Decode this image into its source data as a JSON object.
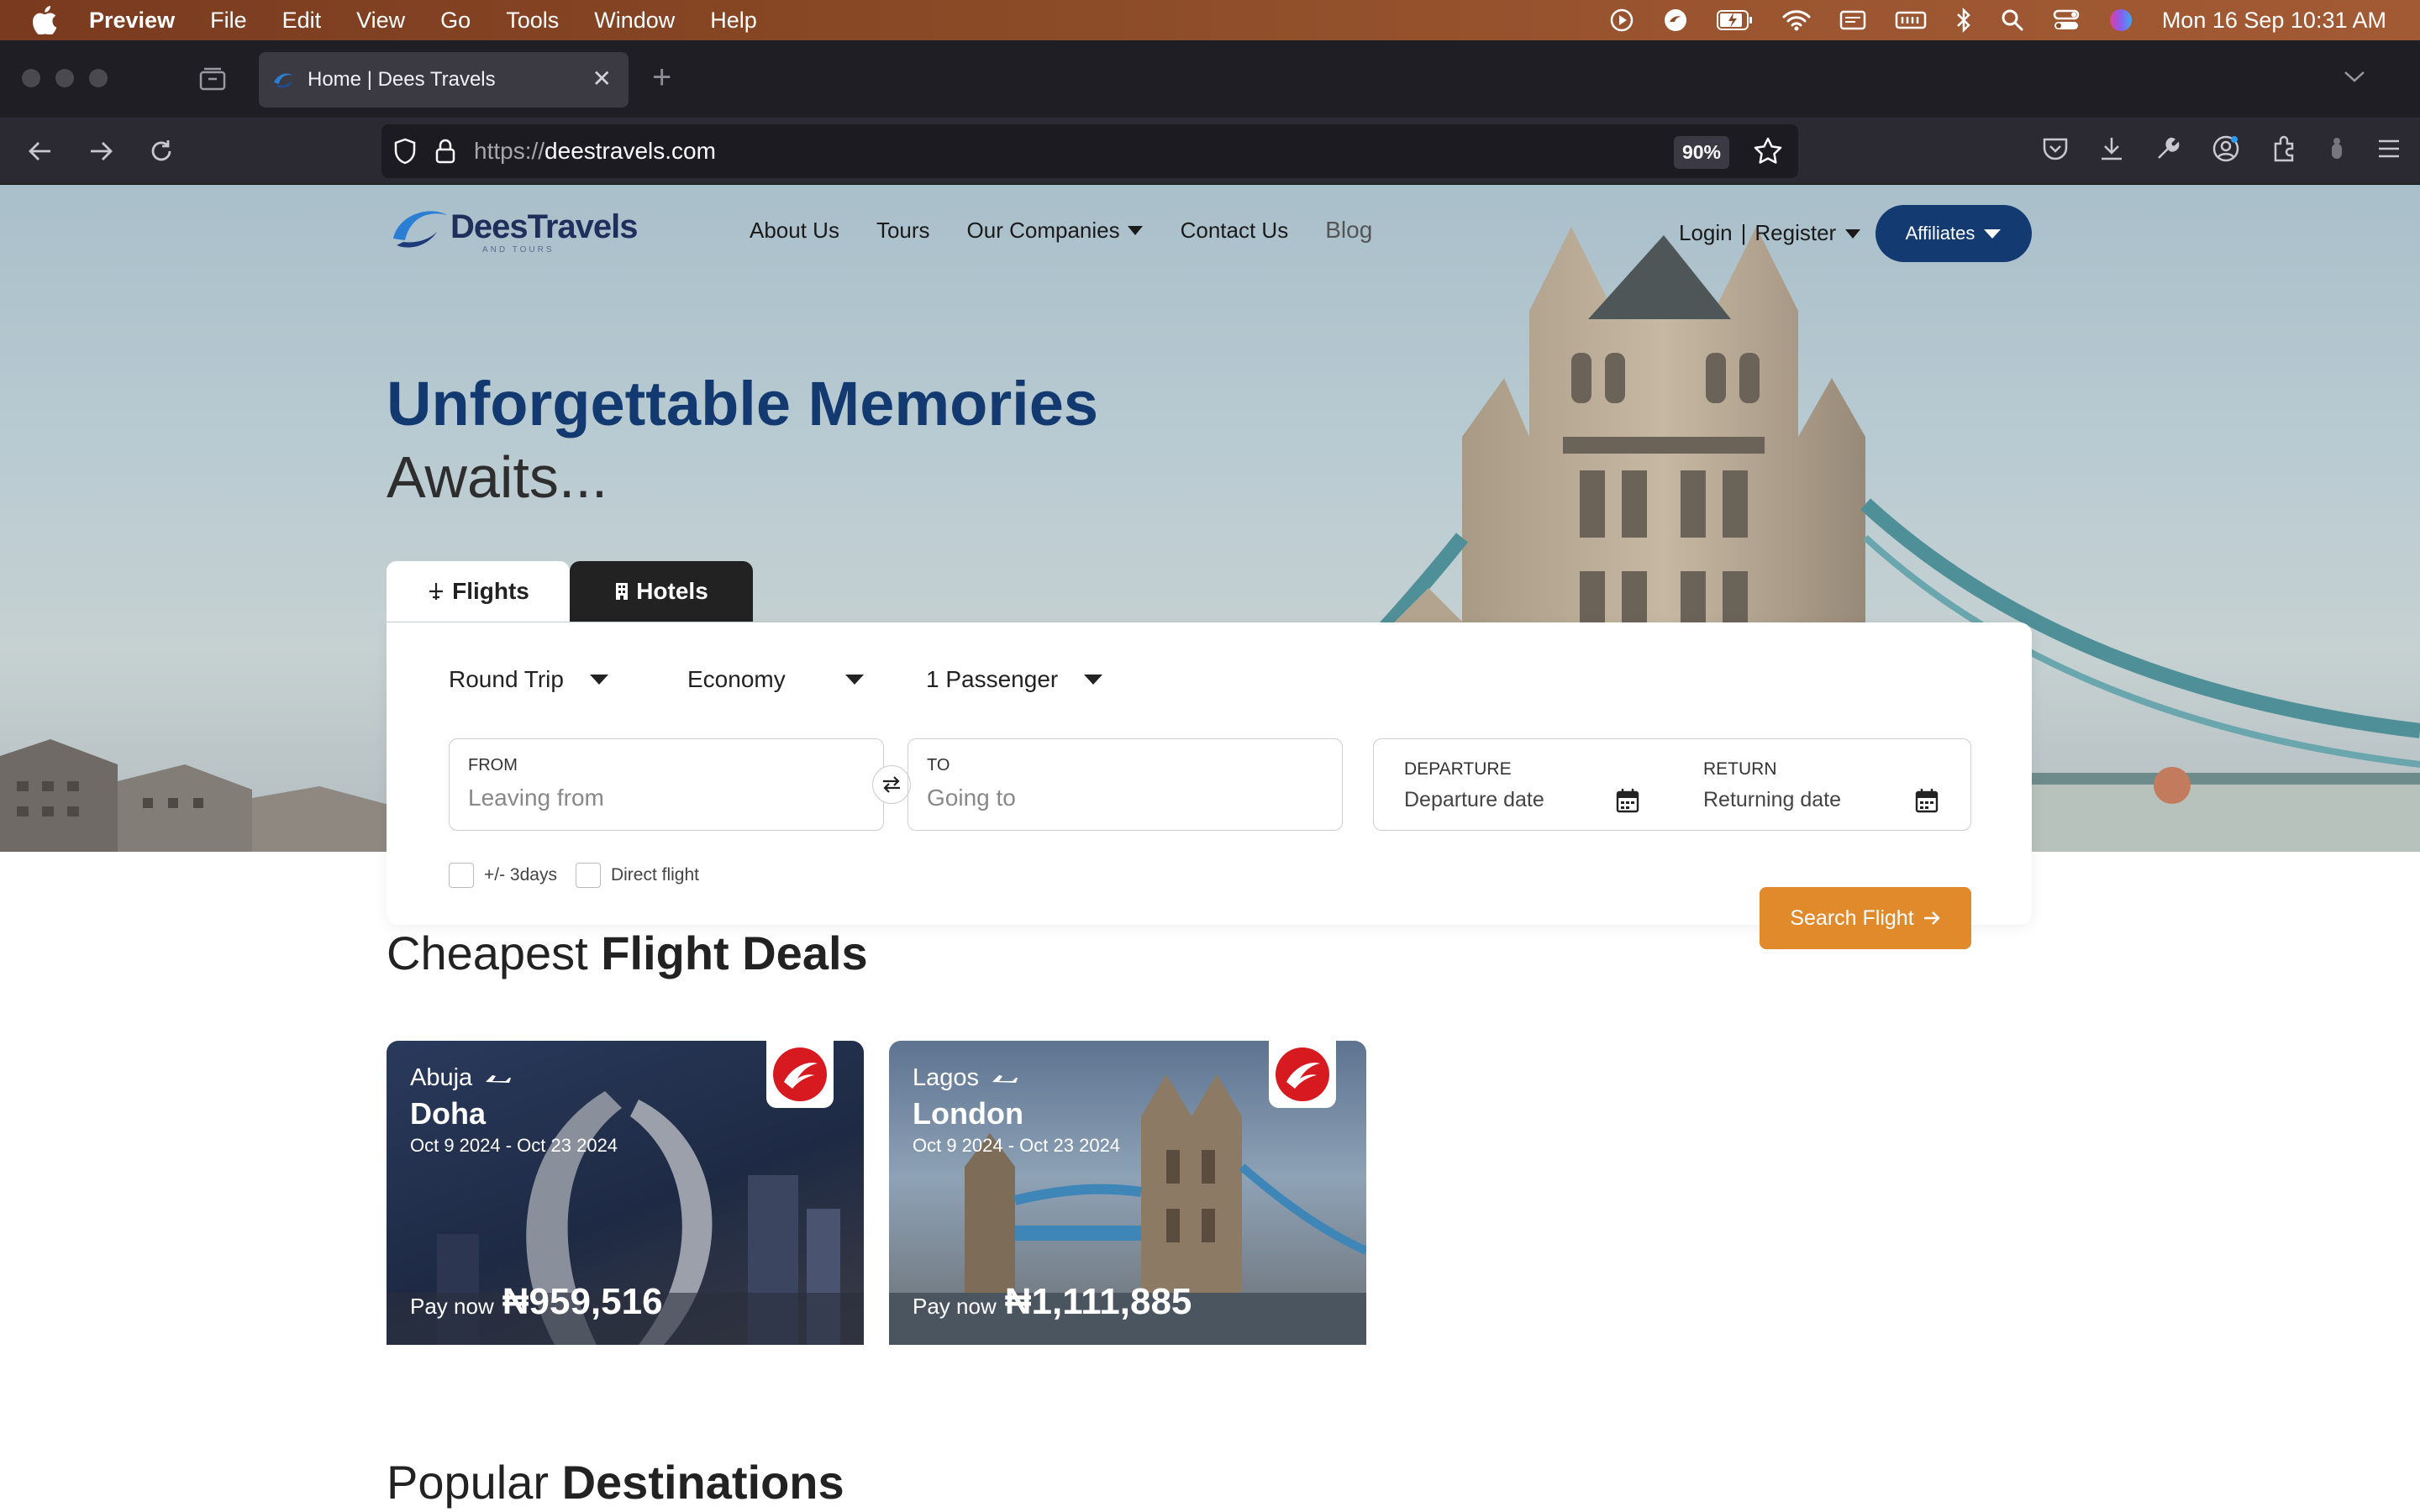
{
  "menubar": {
    "app_name": "Preview",
    "items": [
      "File",
      "Edit",
      "View",
      "Go",
      "Tools",
      "Window",
      "Help"
    ],
    "clock": "Mon 16 Sep  10:31 AM"
  },
  "browser": {
    "tab_title": "Home | Dees Travels",
    "url_protocol": "https://",
    "url_host": "deestravels.com",
    "zoom": "90%"
  },
  "site": {
    "logo_text": "DeesTravels",
    "logo_sub": "AND TOURS",
    "nav": [
      "About Us",
      "Tours",
      "Our Companies",
      "Contact Us",
      "Blog"
    ],
    "login": "Login",
    "separator": "|",
    "register": "Register",
    "affiliates": "Affiliates",
    "colors": {
      "primary": "#143a72",
      "accent": "#e08a2c"
    }
  },
  "hero": {
    "title": "Unforgettable Memories",
    "subtitle": "Awaits..."
  },
  "search": {
    "tabs": [
      "Flights",
      "Hotels"
    ],
    "trip_type": "Round Trip",
    "cabin": "Economy",
    "passengers": "1 Passenger",
    "from_label": "FROM",
    "from_placeholder": "Leaving from",
    "to_label": "TO",
    "to_placeholder": "Going to",
    "departure_label": "DEPARTURE",
    "departure_placeholder": "Departure date",
    "return_label": "RETURN",
    "return_placeholder": "Returning date",
    "flex_label": "+/- 3days",
    "direct_label": "Direct flight",
    "button": "Search Flight"
  },
  "deals": {
    "title_light": "Cheapest",
    "title_bold": "Flight Deals",
    "cards": [
      {
        "from": "Abuja",
        "to": "Doha",
        "dates": "Oct 9 2024 - Oct 23 2024",
        "pay_label": "Pay now",
        "price": "₦959,516"
      },
      {
        "from": "Lagos",
        "to": "London",
        "dates": "Oct 9 2024 - Oct 23 2024",
        "pay_label": "Pay now",
        "price": "₦1,111,885"
      }
    ]
  },
  "destinations": {
    "title_light": "Popular",
    "title_bold": "Destinations"
  }
}
